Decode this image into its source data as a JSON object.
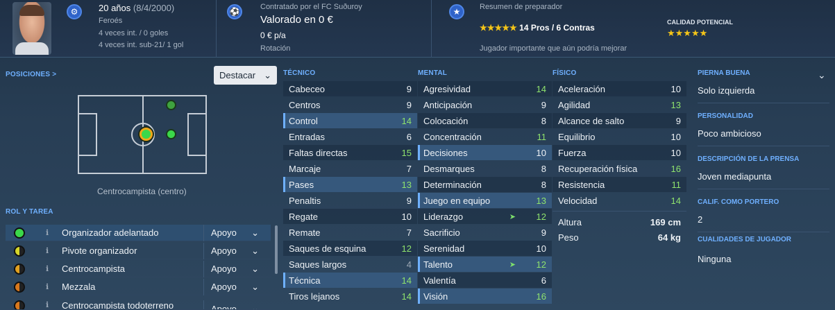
{
  "header": {
    "age": "20 años",
    "birth": "(8/4/2000)",
    "nationality": "Feroés",
    "caps": "4 veces int. / 0 goles",
    "caps_u21": "4 veces int. sub-21/ 1 gol",
    "contract_label": "Contratado por el FC Suðuroy",
    "value": "Valorado en 0 €",
    "wage": "0 € p/a",
    "status": "Rotación",
    "coach_label": "Resumen de preparador",
    "stars": "★★★★★",
    "pros_cons": "14 Pros / 6 Contras",
    "coach_comment": "Jugador importante que aún podría mejorar",
    "potential_label": "CALIDAD POTENCIAL",
    "potential_stars": "★★★★★"
  },
  "positions": {
    "title": "POSICIONES >",
    "highlight": "Destacar",
    "position_name": "Centrocampista (centro)"
  },
  "roles": {
    "title": "ROL Y TAREA",
    "items": [
      {
        "name": "Organizador adelantado",
        "duty": "Apoyo",
        "color": "#3bd84a"
      },
      {
        "name": "Pivote organizador",
        "duty": "Apoyo",
        "color": "#d6d62a"
      },
      {
        "name": "Centrocampista",
        "duty": "Apoyo",
        "color": "#e0a020"
      },
      {
        "name": "Mezzala",
        "duty": "Apoyo",
        "color": "#d9781c"
      },
      {
        "name": "Centrocampista todoterreno",
        "duty": "Apoyo",
        "color": "#d9781c"
      }
    ]
  },
  "technical": {
    "title": "TÉCNICO",
    "rows": [
      {
        "name": "Cabeceo",
        "value": "9"
      },
      {
        "name": "Centros",
        "value": "9"
      },
      {
        "name": "Control",
        "value": "14"
      },
      {
        "name": "Entradas",
        "value": "6"
      },
      {
        "name": "Faltas directas",
        "value": "15"
      },
      {
        "name": "Marcaje",
        "value": "7"
      },
      {
        "name": "Pases",
        "value": "13"
      },
      {
        "name": "Penaltis",
        "value": "9"
      },
      {
        "name": "Regate",
        "value": "10"
      },
      {
        "name": "Remate",
        "value": "7"
      },
      {
        "name": "Saques de esquina",
        "value": "12"
      },
      {
        "name": "Saques largos",
        "value": "4"
      },
      {
        "name": "Técnica",
        "value": "14"
      },
      {
        "name": "Tiros lejanos",
        "value": "14"
      }
    ]
  },
  "mental": {
    "title": "MENTAL",
    "rows": [
      {
        "name": "Agresividad",
        "value": "14"
      },
      {
        "name": "Anticipación",
        "value": "9"
      },
      {
        "name": "Colocación",
        "value": "8"
      },
      {
        "name": "Concentración",
        "value": "11"
      },
      {
        "name": "Decisiones",
        "value": "10"
      },
      {
        "name": "Desmarques",
        "value": "8"
      },
      {
        "name": "Determinación",
        "value": "8"
      },
      {
        "name": "Juego en equipo",
        "value": "13"
      },
      {
        "name": "Liderazgo",
        "value": "12"
      },
      {
        "name": "Sacrificio",
        "value": "9"
      },
      {
        "name": "Serenidad",
        "value": "10"
      },
      {
        "name": "Talento",
        "value": "12"
      },
      {
        "name": "Valentía",
        "value": "6"
      },
      {
        "name": "Visión",
        "value": "16"
      }
    ]
  },
  "physical": {
    "title": "FÍSICO",
    "rows": [
      {
        "name": "Aceleración",
        "value": "10"
      },
      {
        "name": "Agilidad",
        "value": "13"
      },
      {
        "name": "Alcance de salto",
        "value": "9"
      },
      {
        "name": "Equilibrio",
        "value": "10"
      },
      {
        "name": "Fuerza",
        "value": "10"
      },
      {
        "name": "Recuperación física",
        "value": "16"
      },
      {
        "name": "Resistencia",
        "value": "11"
      },
      {
        "name": "Velocidad",
        "value": "14"
      }
    ],
    "height_label": "Altura",
    "height": "169 cm",
    "weight_label": "Peso",
    "weight": "64 kg"
  },
  "info": {
    "foot_label": "PIERNA BUENA",
    "foot": "Solo izquierda",
    "personality_label": "PERSONALIDAD",
    "personality": "Poco ambicioso",
    "press_label": "DESCRIPCIÓN DE LA PRENSA",
    "press": "Joven mediapunta",
    "gk_label": "CALIF. COMO PORTERO",
    "gk": "2",
    "qualities_label": "CUALIDADES DE JUGADOR",
    "qualities": "Ninguna"
  },
  "colors": {
    "accent": "#6fb0ff",
    "good": "#8fe36d"
  }
}
